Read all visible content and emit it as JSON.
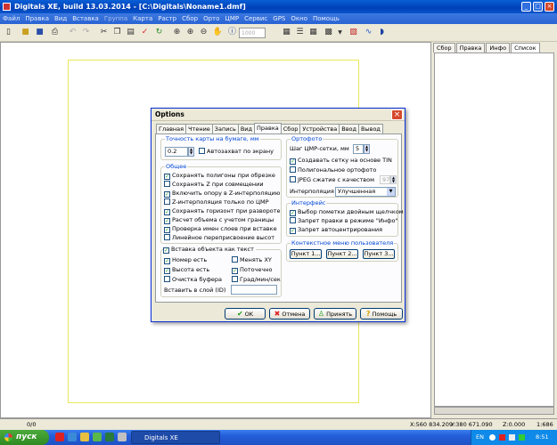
{
  "app": {
    "title": "Digitals XE, build 13.03.2014 - [C:\\Digitals\\Noname1.dmf]",
    "window_buttons": [
      "_",
      "□",
      "×"
    ]
  },
  "menu": [
    "Файл",
    "Правка",
    "Вид",
    "Вставка",
    "Группа",
    "Карта",
    "Растр",
    "Сбор",
    "Орто",
    "ЦМР",
    "Сервис",
    "GPS",
    "Окно",
    "Помощь"
  ],
  "toolbar": {
    "zoom_value": "1000"
  },
  "right_panel": {
    "tabs": [
      "Сбор",
      "Правка",
      "Инфо",
      "Список"
    ],
    "active_tab": "Список"
  },
  "statusbar": {
    "left": "0/0",
    "x": "X:560 834.209",
    "y": "Y:380 671.090",
    "z": "Z:0.000",
    "scale": "1:686"
  },
  "taskbar": {
    "start_label": "пуск",
    "task_label": "Digitals XE",
    "lang": "EN",
    "clock": "8:51"
  },
  "dialog": {
    "title": "Options",
    "tabs": [
      "Главная",
      "Чтение",
      "Запись",
      "Вид",
      "Правка",
      "Сбор",
      "Устройства",
      "Ввод",
      "Вывод"
    ],
    "active_tab": "Правка",
    "accuracy_group": {
      "title": "Точность карты на бумаге, мм",
      "value": "0.2",
      "autocapture_label": "Автозахват по экрану",
      "autocapture_checked": false
    },
    "general_group": {
      "title": "Общее",
      "items": [
        {
          "label": "Сохранять полигоны при обрезке",
          "checked": true
        },
        {
          "label": "Сохранять Z при совмещении",
          "checked": false
        },
        {
          "label": "Включить опору в Z-интерполяцию",
          "checked": true
        },
        {
          "label": "Z-интерполяция только по ЦМР",
          "checked": false
        },
        {
          "label": "Сохранять горизонт при развороте",
          "checked": true
        },
        {
          "label": "Расчет объема с учетом границы",
          "checked": true
        },
        {
          "label": "Проверка имен слоев при вставке",
          "checked": true
        },
        {
          "label": "Линейное переприсвоение высот",
          "checked": false
        }
      ]
    },
    "insert_group": {
      "title": "Вставка объекта как текст",
      "title_checked": true,
      "left": [
        {
          "label": "Номер есть",
          "checked": true
        },
        {
          "label": "Высота есть",
          "checked": true
        },
        {
          "label": "Очистка буфера",
          "checked": false
        }
      ],
      "right": [
        {
          "label": "Менять XY",
          "checked": false
        },
        {
          "label": "Поточечно",
          "checked": true
        },
        {
          "label": "Град/мин/сек",
          "checked": false
        }
      ],
      "layer_label": "Вставить в слой (ID)",
      "layer_value": ""
    },
    "ortho_group": {
      "title": "Ортофото",
      "grid_step_label": "Шаг ЦМР-сетки, мм",
      "grid_step_value": "5",
      "items": [
        {
          "label": "Создавать сетку на основе TIN",
          "checked": true
        },
        {
          "label": "Полигональное ортофото",
          "checked": false
        },
        {
          "label": "JPEG сжатие с качеством",
          "checked": false
        }
      ],
      "jpeg_quality": "97",
      "interp_label": "Интерполяция",
      "interp_value": "Улучшенная"
    },
    "interface_group": {
      "title": "Интерфейс",
      "items": [
        {
          "label": "Выбор пометки двойным щелчком",
          "checked": true
        },
        {
          "label": "Запрет правки в режиме \"Инфо\"",
          "checked": false
        },
        {
          "label": "Запрет автоцентрирования",
          "checked": true
        }
      ]
    },
    "context_group": {
      "title": "Контекстное меню пользователя",
      "buttons": [
        "Пункт 1...",
        "Пункт 2...",
        "Пункт 3..."
      ]
    },
    "buttons": {
      "ok": "OK",
      "cancel": "Отмена",
      "apply": "Принять",
      "help": "Помощь"
    },
    "colors": {
      "group_title": "#0046d5",
      "check": "#21a121"
    }
  }
}
